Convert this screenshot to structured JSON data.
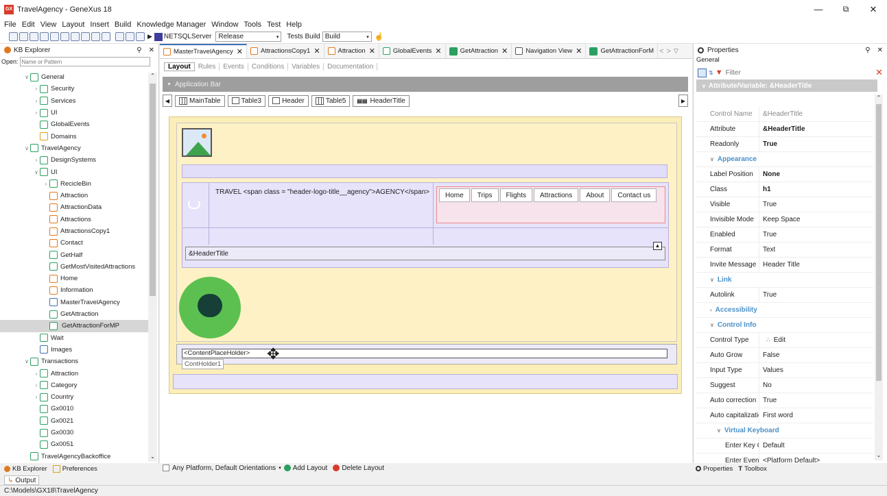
{
  "app": {
    "title": "TravelAgency - GeneXus 18",
    "logo": "GX"
  },
  "menu": [
    "File",
    "Edit",
    "View",
    "Layout",
    "Insert",
    "Build",
    "Knowledge Manager",
    "Window",
    "Tools",
    "Test",
    "Help"
  ],
  "toolbar": {
    "server": "NETSQLServer",
    "config": "Release",
    "tests_build_label": "Tests Build",
    "build": "Build"
  },
  "kb_explorer": {
    "title": "KB Explorer",
    "open_label": "Open:",
    "open_placeholder": "Name or Pattern",
    "items": [
      {
        "label": "General",
        "indent": 1,
        "arrow": "v",
        "color": "#2aa060"
      },
      {
        "label": "Security",
        "indent": 2,
        "arrow": ">",
        "color": "#2aa060"
      },
      {
        "label": "Services",
        "indent": 2,
        "arrow": ">",
        "color": "#2aa060"
      },
      {
        "label": "UI",
        "indent": 2,
        "arrow": ">",
        "color": "#2aa060"
      },
      {
        "label": "GlobalEvents",
        "indent": 2,
        "arrow": "",
        "color": "#2aa060"
      },
      {
        "label": "Domains",
        "indent": 2,
        "arrow": "",
        "color": "#d9a21b"
      },
      {
        "label": "TravelAgency",
        "indent": 1,
        "arrow": "v",
        "color": "#2aa060"
      },
      {
        "label": "DesignSystems",
        "indent": 2,
        "arrow": ">",
        "color": "#2aa060"
      },
      {
        "label": "UI",
        "indent": 2,
        "arrow": "v",
        "color": "#2aa060"
      },
      {
        "label": "RecicleBin",
        "indent": 3,
        "arrow": ">",
        "color": "#2aa060"
      },
      {
        "label": "Attraction",
        "indent": 3,
        "arrow": "",
        "color": "#e07820"
      },
      {
        "label": "AttractionData",
        "indent": 3,
        "arrow": "",
        "color": "#e07820"
      },
      {
        "label": "Attractions",
        "indent": 3,
        "arrow": "",
        "color": "#e07820"
      },
      {
        "label": "AttractionsCopy1",
        "indent": 3,
        "arrow": "",
        "color": "#e07820"
      },
      {
        "label": "Contact",
        "indent": 3,
        "arrow": "",
        "color": "#e07820"
      },
      {
        "label": "GetHalf",
        "indent": 3,
        "arrow": "",
        "color": "#2aa060"
      },
      {
        "label": "GetMostVisitedAttractions",
        "indent": 3,
        "arrow": "",
        "color": "#2aa060"
      },
      {
        "label": "Home",
        "indent": 3,
        "arrow": "",
        "color": "#e07820"
      },
      {
        "label": "Information",
        "indent": 3,
        "arrow": "",
        "color": "#e07820"
      },
      {
        "label": "MasterTravelAgency",
        "indent": 3,
        "arrow": "",
        "color": "#3d6fb4"
      },
      {
        "label": "GetAttraction",
        "indent": 3,
        "arrow": "",
        "color": "#2aa060"
      },
      {
        "label": "GetAttractionForMP",
        "indent": 3,
        "arrow": "",
        "color": "#2aa060",
        "selected": true
      },
      {
        "label": "Wait",
        "indent": 2,
        "arrow": "",
        "color": "#2aa060"
      },
      {
        "label": "Images",
        "indent": 2,
        "arrow": "",
        "color": "#3d6fb4"
      },
      {
        "label": "Transactions",
        "indent": 1,
        "arrow": "v",
        "color": "#2aa060"
      },
      {
        "label": "Attraction",
        "indent": 2,
        "arrow": ">",
        "color": "#2aa060"
      },
      {
        "label": "Category",
        "indent": 2,
        "arrow": ">",
        "color": "#2aa060"
      },
      {
        "label": "Country",
        "indent": 2,
        "arrow": ">",
        "color": "#2aa060"
      },
      {
        "label": "Gx0010",
        "indent": 2,
        "arrow": "",
        "color": "#2aa060"
      },
      {
        "label": "Gx0021",
        "indent": 2,
        "arrow": "",
        "color": "#2aa060"
      },
      {
        "label": "Gx0030",
        "indent": 2,
        "arrow": "",
        "color": "#2aa060"
      },
      {
        "label": "Gx0051",
        "indent": 2,
        "arrow": "",
        "color": "#2aa060"
      },
      {
        "label": "TravelAgencyBackoffice",
        "indent": 1,
        "arrow": "",
        "color": "#2aa060"
      }
    ],
    "bottom_tabs": [
      "KB Explorer",
      "Preferences"
    ]
  },
  "editor": {
    "tabs": [
      "MasterTravelAgency",
      "AttractionsCopy1",
      "Attraction",
      "GlobalEvents",
      "GetAttraction",
      "Navigation View",
      "GetAttractionForM"
    ],
    "subtabs": [
      "Layout",
      "Rules",
      "Events",
      "Conditions",
      "Variables",
      "Documentation"
    ],
    "app_bar": "Application Bar",
    "breadcrumbs": [
      "MainTable",
      "Table3",
      "Header",
      "Table5",
      "HeaderTitle"
    ],
    "header_text": "TRAVEL <span class = \"header-logo-title__agency\">AGENCY</span>",
    "nav_buttons": [
      "Home",
      "Trips",
      "Flights",
      "Attractions",
      "About",
      "Contact us"
    ],
    "header_title_var": "&HeaderTitle",
    "content_placeholder": "<ContentPlaceHolder>",
    "content_holder_name": "ContHolder1",
    "footer_platform": "Any Platform, Default Orientations",
    "add_layout": "Add Layout",
    "delete_layout": "Delete Layout"
  },
  "properties": {
    "title": "Properties",
    "tab": "General",
    "filter_placeholder": "Filter",
    "header": "Attribute/Variable: &HeaderTitle",
    "rows": [
      {
        "name": "Control Name",
        "value": "&HeaderTitle",
        "kind": "dim"
      },
      {
        "name": "Attribute",
        "value": "&HeaderTitle",
        "kind": "bold"
      },
      {
        "name": "Readonly",
        "value": "True",
        "kind": "bold"
      },
      {
        "name": "Appearance",
        "value": "",
        "kind": "cat"
      },
      {
        "name": "Label Position",
        "value": "None",
        "kind": "bold"
      },
      {
        "name": "Class",
        "value": "h1",
        "kind": "bold"
      },
      {
        "name": "Visible",
        "value": "True",
        "kind": ""
      },
      {
        "name": "Invisible Mode",
        "value": "Keep Space",
        "kind": ""
      },
      {
        "name": "Enabled",
        "value": "True",
        "kind": ""
      },
      {
        "name": "Format",
        "value": "Text",
        "kind": ""
      },
      {
        "name": "Invite Message",
        "value": "Header Title",
        "kind": ""
      },
      {
        "name": "Link",
        "value": "",
        "kind": "cat"
      },
      {
        "name": "Autolink",
        "value": "True",
        "kind": ""
      },
      {
        "name": "Accessibility",
        "value": "",
        "kind": "catc"
      },
      {
        "name": "Control Info",
        "value": "",
        "kind": "cat"
      },
      {
        "name": "Control Type",
        "value": "Edit",
        "kind": ""
      },
      {
        "name": "Auto Grow",
        "value": "False",
        "kind": ""
      },
      {
        "name": "Input Type",
        "value": "Values",
        "kind": ""
      },
      {
        "name": "Suggest",
        "value": "No",
        "kind": ""
      },
      {
        "name": "Auto correction",
        "value": "True",
        "kind": ""
      },
      {
        "name": "Auto capitalization",
        "value": "First word",
        "kind": ""
      },
      {
        "name": "Virtual Keyboard",
        "value": "",
        "kind": "cat2"
      },
      {
        "name": "Enter Key Caption",
        "value": "Default",
        "kind": "sub"
      },
      {
        "name": "Enter Event",
        "value": "<Platform Default>",
        "kind": "sub"
      }
    ],
    "bottom_tabs": [
      "Properties",
      "Toolbox"
    ]
  },
  "output_label": "Output",
  "status_path": "C:\\Models\\GX18\\TravelAgency"
}
